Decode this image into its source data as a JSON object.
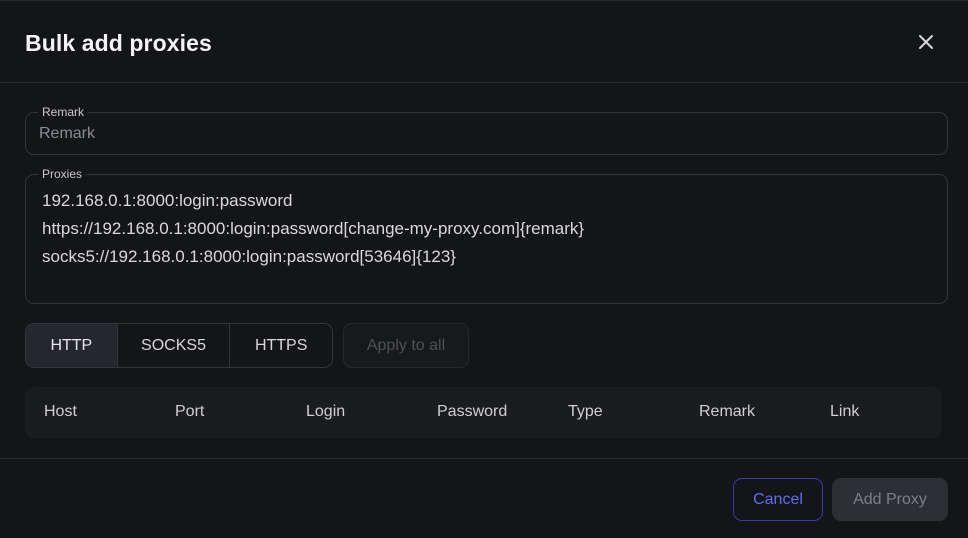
{
  "dialog": {
    "title": "Bulk add proxies",
    "close_icon": "close-icon"
  },
  "remark": {
    "label": "Remark",
    "placeholder": "Remark",
    "value": ""
  },
  "proxies": {
    "label": "Proxies",
    "lines": [
      "192.168.0.1:8000:login:password",
      "https://192.168.0.1:8000:login:password[change-my-proxy.com]{remark}",
      "socks5://192.168.0.1:8000:login:password[53646]{123}"
    ]
  },
  "proxy_types": {
    "options": [
      "HTTP",
      "SOCKS5",
      "HTTPS"
    ],
    "selected": "HTTP"
  },
  "apply_all": {
    "label": "Apply to all"
  },
  "table": {
    "columns": [
      "Host",
      "Port",
      "Login",
      "Password",
      "Type",
      "Remark",
      "Link"
    ]
  },
  "footer": {
    "cancel_label": "Cancel",
    "add_label": "Add Proxy"
  },
  "colors": {
    "background": "#141519",
    "accent": "#5e6cf2",
    "border": "#34353b"
  }
}
